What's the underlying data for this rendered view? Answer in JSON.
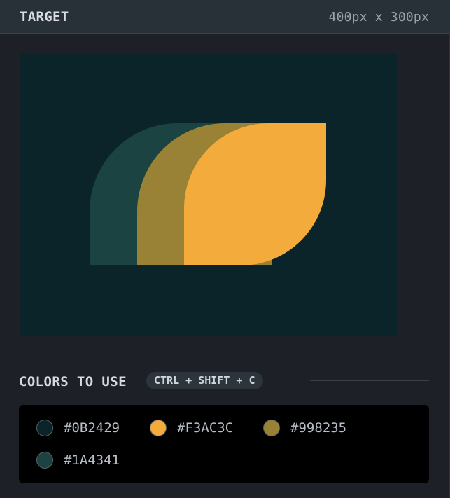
{
  "header": {
    "title": "TARGET",
    "size_label": "400px x 300px"
  },
  "target": {
    "background": "#0B2429",
    "shapes": [
      {
        "name": "back-arch",
        "color": "#1A4341"
      },
      {
        "name": "middle-arch",
        "color": "#998235"
      },
      {
        "name": "front-leaf",
        "color": "#F3AC3C"
      }
    ]
  },
  "colors_section": {
    "title": "COLORS TO USE",
    "shortcut": "CTRL + SHIFT + C"
  },
  "palette": [
    {
      "hex": "#0B2429",
      "label": "#0B2429"
    },
    {
      "hex": "#F3AC3C",
      "label": "#F3AC3C"
    },
    {
      "hex": "#998235",
      "label": "#998235"
    },
    {
      "hex": "#1A4341",
      "label": "#1A4341"
    }
  ]
}
